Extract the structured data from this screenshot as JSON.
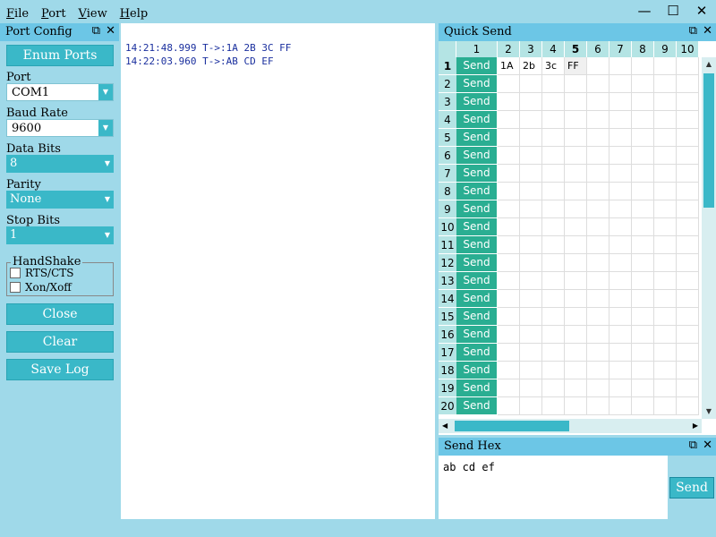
{
  "menu": {
    "items": [
      {
        "label": "File",
        "accel": "F",
        "rest": "ile"
      },
      {
        "label": "Port",
        "accel": "P",
        "rest": "ort"
      },
      {
        "label": "View",
        "accel": "V",
        "rest": "iew"
      },
      {
        "label": "Help",
        "accel": "H",
        "rest": "elp"
      }
    ]
  },
  "window_controls": {
    "minimize": "—",
    "maximize": "☐",
    "close": "✕"
  },
  "port_config": {
    "title": "Port Config",
    "enum_ports_label": "Enum Ports",
    "port_label": "Port",
    "port_value": "COM1",
    "baud_label": "Baud Rate",
    "baud_value": "9600",
    "data_bits_label": "Data Bits",
    "data_bits_value": "8",
    "parity_label": "Parity",
    "parity_value": "None",
    "stop_bits_label": "Stop Bits",
    "stop_bits_value": "1",
    "handshake_label": "HandShake",
    "rts_label": "RTS/CTS",
    "xon_label": "Xon/Xoff",
    "close_label": "Close",
    "clear_label": "Clear",
    "save_log_label": "Save Log"
  },
  "log": {
    "lines": [
      "14:21:48.999 T->:1A 2B 3C FF",
      "14:22:03.960 T->:AB CD EF"
    ]
  },
  "quick_send": {
    "title": "Quick Send",
    "columns": [
      "1",
      "2",
      "3",
      "4",
      "5",
      "6",
      "7",
      "8",
      "9",
      "10"
    ],
    "send_label": "Send",
    "rows": [
      "1",
      "2",
      "3",
      "4",
      "5",
      "6",
      "7",
      "8",
      "9",
      "10",
      "11",
      "12",
      "13",
      "14",
      "15",
      "16",
      "17",
      "18",
      "19",
      "20"
    ],
    "row1_values": [
      "1A",
      "2b",
      "3c",
      "FF"
    ]
  },
  "send_hex": {
    "title": "Send Hex",
    "value": "ab cd ef",
    "send_label": "Send"
  },
  "icons": {
    "float": "⧉",
    "close": "✕",
    "dropdown": "▼",
    "up": "▲",
    "down": "▼",
    "left": "◀",
    "right": "▶"
  },
  "colors": {
    "accent": "#3ab8c8",
    "send_cell": "#2aae92",
    "background": "#9fd9e9",
    "header": "#6cc6e6",
    "log_text": "#1a2f9e"
  }
}
